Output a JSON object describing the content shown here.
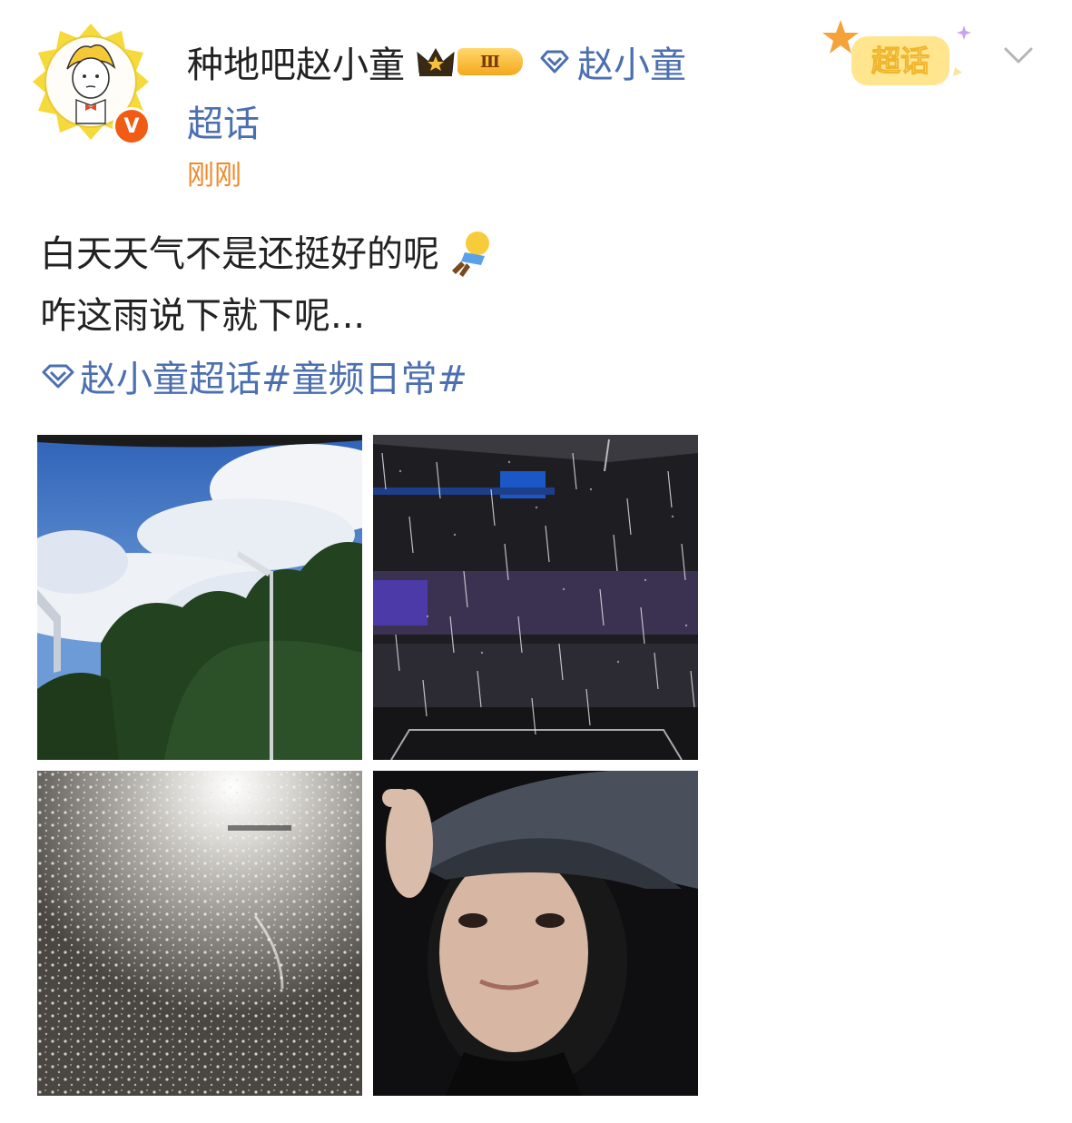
{
  "post": {
    "author": {
      "name": "种地吧赵小童",
      "level_badge": "Ⅲ",
      "verified_badge": "V"
    },
    "supertopic": {
      "name": "赵小童",
      "suffix": "超话"
    },
    "timestamp": "刚刚",
    "super_badge_label": "超话",
    "text_lines": [
      "白天天气不是还挺好的呢",
      "咋这雨说下就下呢..."
    ],
    "hashtag": {
      "topic": "赵小童超话",
      "tag": "#童频日常#"
    },
    "images": [
      {
        "description": "sky-trees-streetlight"
      },
      {
        "description": "rain-stage-night"
      },
      {
        "description": "rain-lights"
      },
      {
        "description": "selfie-bucket-hat"
      }
    ]
  },
  "icons": {
    "topic": "diamond-topic-icon",
    "crown": "crown-icon",
    "more": "chevron-down-icon",
    "emoji": "lying-flat-emoji-icon"
  },
  "colors": {
    "link": "#4b6fb0",
    "timestamp": "#ee8a2c",
    "text": "#222222",
    "verify": "#f25b14"
  }
}
